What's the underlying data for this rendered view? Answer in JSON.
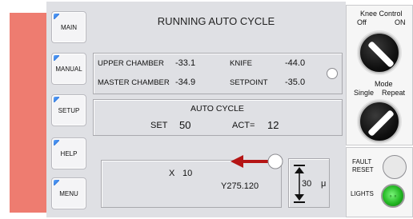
{
  "title": "RUNNING AUTO CYCLE",
  "nav": [
    {
      "label": "MAIN"
    },
    {
      "label": "MANUAL"
    },
    {
      "label": "SETUP"
    },
    {
      "label": "HELP"
    },
    {
      "label": "MENU"
    }
  ],
  "readings": {
    "upper_chamber_label": "UPPER CHAMBER",
    "upper_chamber_value": "-33.1",
    "master_chamber_label": "MASTER CHAMBER",
    "master_chamber_value": "-34.9",
    "knife_label": "KNIFE",
    "knife_value": "-44.0",
    "setpoint_label": "SETPOINT",
    "setpoint_value": "-35.0"
  },
  "auto_cycle": {
    "heading": "AUTO CYCLE",
    "set_label": "SET",
    "set_value": "50",
    "act_label": "ACT=",
    "act_value": "12"
  },
  "position": {
    "x_label": "X",
    "x_value": "10",
    "y_value": "Y275.120",
    "thickness_value": "30",
    "thickness_unit": "μ"
  },
  "knee_control": {
    "title": "Knee Control",
    "off_label": "Off",
    "on_label": "ON"
  },
  "mode": {
    "title": "Mode",
    "single_label": "Single",
    "repeat_label": "Repeat"
  },
  "fault_reset": {
    "line1": "FAULT",
    "line2": "RESET"
  },
  "lights": {
    "label": "LIGHTS"
  },
  "colors": {
    "accent_salmon": "#ee7c70",
    "arrow_red": "#b51515",
    "lights_green": "#23b823"
  }
}
